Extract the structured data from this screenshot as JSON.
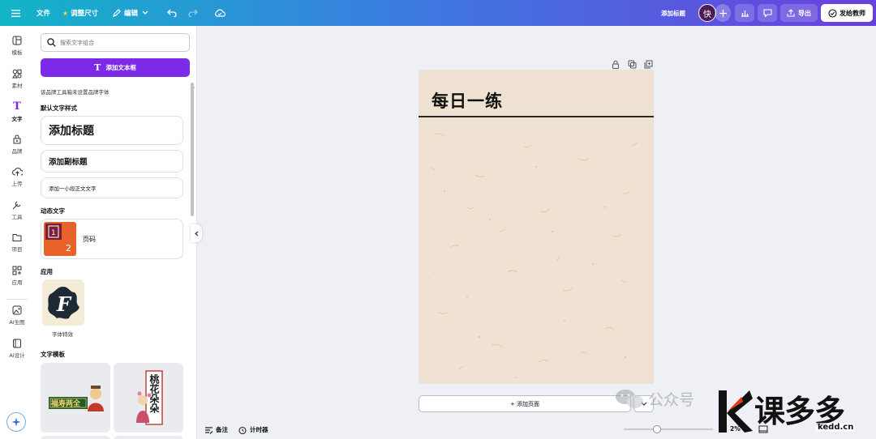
{
  "topbar": {
    "file": "文件",
    "resize": "调整尺寸",
    "edit": "编辑",
    "add_title": "添加标题",
    "avatar": "快",
    "export": "导出",
    "share": "发给教师"
  },
  "rail": [
    {
      "label": "模板",
      "icon": "template-icon"
    },
    {
      "label": "素材",
      "icon": "elements-icon"
    },
    {
      "label": "文字",
      "icon": "text-icon"
    },
    {
      "label": "品牌",
      "icon": "brand-icon"
    },
    {
      "label": "上传",
      "icon": "upload-icon"
    },
    {
      "label": "工具",
      "icon": "tools-icon"
    },
    {
      "label": "项目",
      "icon": "folder-icon"
    },
    {
      "label": "应用",
      "icon": "apps-icon"
    },
    {
      "label": "AI生图",
      "icon": "ai-image-icon"
    },
    {
      "label": "AI设计",
      "icon": "ai-design-icon"
    }
  ],
  "panel": {
    "search_placeholder": "搜索文字组合",
    "add_textbox": "添加文本框",
    "brand_note": "该品牌工具箱未设置品牌字体",
    "default_styles": "默认文字样式",
    "heading": "添加标题",
    "subheading": "添加副标题",
    "body": "添加一小段正文文字",
    "dynamic": "动态文字",
    "page_number": "页码",
    "apps": "应用",
    "font_effects": "字体特效",
    "templates": "文字模板",
    "tpl1_text": "福寿两全",
    "tpl2_text": "桃花朵朵"
  },
  "canvas": {
    "page_title": "每日一练",
    "add_page": "+ 添加页面"
  },
  "bottombar": {
    "notes": "备注",
    "timer": "计时器",
    "zoom": "2%"
  },
  "watermark": {
    "wechat": "公众号",
    "brand": "课多多",
    "url": "kedd.cn"
  }
}
